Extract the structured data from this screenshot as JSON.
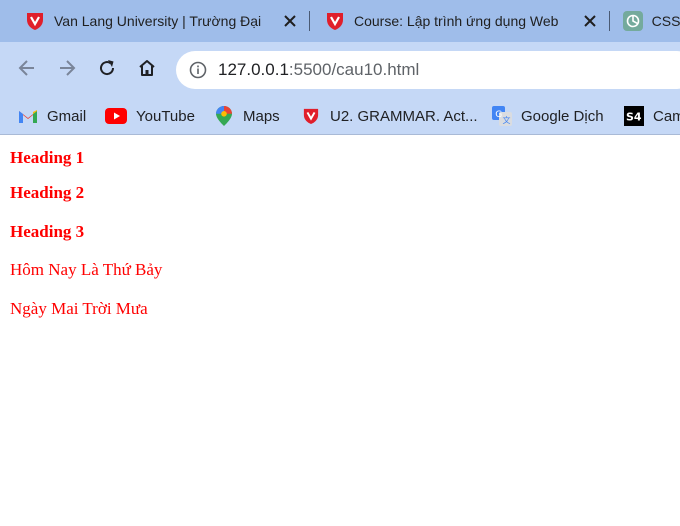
{
  "browser": {
    "tabs": [
      {
        "title": "Van Lang University | Trường Đại",
        "favicon": "vlu-shield-icon"
      },
      {
        "title": "Course: Lập trình ứng dụng Web",
        "favicon": "vlu-shield-icon"
      },
      {
        "title": "CSS",
        "favicon": "chatgpt-icon"
      }
    ],
    "address": {
      "host": "127.0.0.1",
      "path": ":5500/cau10.html"
    },
    "bookmarks": [
      {
        "label": "Gmail",
        "icon": "gmail-icon"
      },
      {
        "label": "YouTube",
        "icon": "youtube-icon"
      },
      {
        "label": "Maps",
        "icon": "maps-icon"
      },
      {
        "label": "U2. GRAMMAR. Act...",
        "icon": "vlu-shield-icon"
      },
      {
        "label": "Google Dịch",
        "icon": "google-translate-icon"
      },
      {
        "label": "Cam",
        "icon": "s4-icon"
      }
    ]
  },
  "page": {
    "heading1": "Heading 1",
    "heading2": "Heading 2",
    "heading3": "Heading 3",
    "paragraph1": "Hôm Nay Là Thứ Bảy",
    "paragraph2": "Ngày Mai Trời Mưa"
  },
  "colors": {
    "tabstrip": "#9fbdea",
    "toolbar": "#c5d8f6",
    "text_red": "#ff0000"
  }
}
